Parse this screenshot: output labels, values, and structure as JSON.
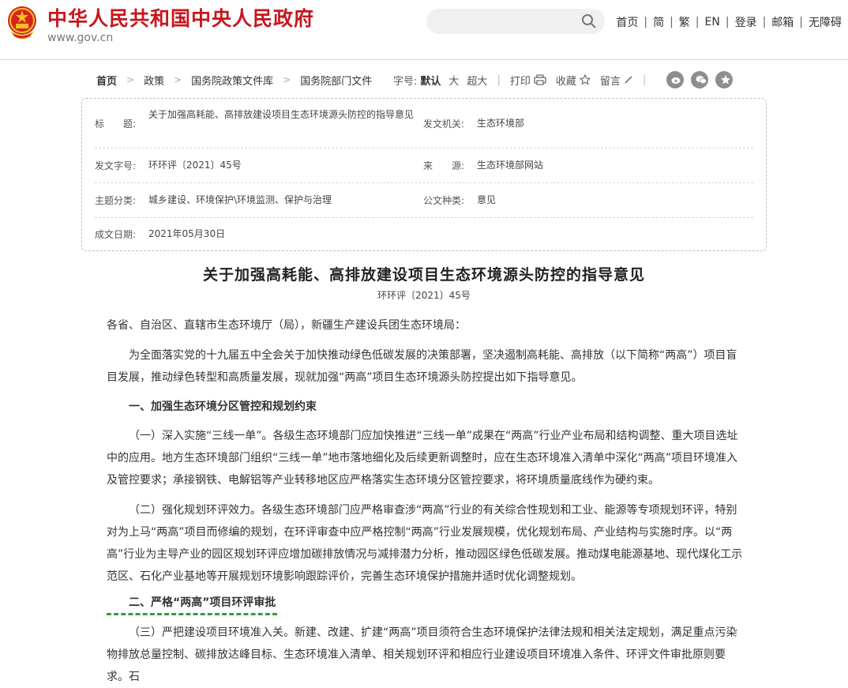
{
  "header": {
    "site_title": "中华人民共和国中央人民政府",
    "site_domain": "www.gov.cn",
    "search_placeholder": "",
    "nav": [
      "首页",
      "简",
      "繁",
      "EN",
      "登录",
      "邮箱",
      "无障碍"
    ],
    "colors": {
      "brand_red": "#c8161d"
    }
  },
  "breadcrumb": [
    "首页",
    "政策",
    "国务院政策文件库",
    "国务院部门文件"
  ],
  "tools": {
    "font_label": "字号:",
    "font_sizes": [
      "默认",
      "大",
      "超大"
    ],
    "print": "打印",
    "favorite": "收藏",
    "comment": "留言",
    "share_icons": [
      "weibo-icon",
      "wechat-icon",
      "favorite-star-icon"
    ]
  },
  "meta": {
    "title_label": "标　　题:",
    "title_value": "关于加强高耗能、高排放建设项目生态环境源头防控的指导意见",
    "issuer_label": "发文机关:",
    "issuer_value": "生态环境部",
    "docno_label": "发文字号:",
    "docno_value": "环环评〔2021〕45号",
    "source_label": "来　　源:",
    "source_value": "生态环境部网站",
    "category_label": "主题分类:",
    "category_value": "城乡建设、环境保护\\环境监测、保护与治理",
    "type_label": "公文种类:",
    "type_value": "意见",
    "date_label": "成文日期:",
    "date_value": "2021年05月30日"
  },
  "document": {
    "title": "关于加强高耗能、高排放建设项目生态环境源头防控的指导意见",
    "number": "环环评〔2021〕45号",
    "salutation": "各省、自治区、直辖市生态环境厅（局），新疆生产建设兵团生态环境局：",
    "intro": "为全面落实党的十九届五中全会关于加快推动绿色低碳发展的决策部署，坚决遏制高耗能、高排放（以下简称“两高”）项目盲目发展，推动绿色转型和高质量发展，现就加强“两高”项目生态环境源头防控提出如下指导意见。",
    "section1": "一、加强生态环境分区管控和规划约束",
    "p1": "（一）深入实施“三线一单”。各级生态环境部门应加快推进“三线一单”成果在“两高”行业产业布局和结构调整、重大项目选址中的应用。地方生态环境部门组织“三线一单”地市落地细化及后续更新调整时，应在生态环境准入清单中深化“两高”项目环境准入及管控要求；承接钢铁、电解铝等产业转移地区应严格落实生态环境分区管控要求，将环境质量底线作为硬约束。",
    "p2": "（二）强化规划环评效力。各级生态环境部门应严格审查涉“两高”行业的有关综合性规划和工业、能源等专项规划环评，特别对为上马“两高”项目而修编的规划，在环评审查中应严格控制“两高”行业发展规模，优化规划布局、产业结构与实施时序。以“两高”行业为主导产业的园区规划环评应增加碳排放情况与减排潜力分析，推动园区绿色低碳发展。推动煤电能源基地、现代煤化工示范区、石化产业基地等开展规划环境影响跟踪评价，完善生态环境保护措施并适时优化调整规划。",
    "section2": "二、严格“两高”项目环评审批",
    "p3": "（三）严把建设项目环境准入关。新建、改建、扩建“两高”项目须符合生态环境保护法律法规和相关法定规划，满足重点污染物排放总量控制、碳排放达峰目标、生态环境准入清单、相关规划环评和相应行业建设项目环境准入条件、环评文件审批原则要求。石"
  }
}
